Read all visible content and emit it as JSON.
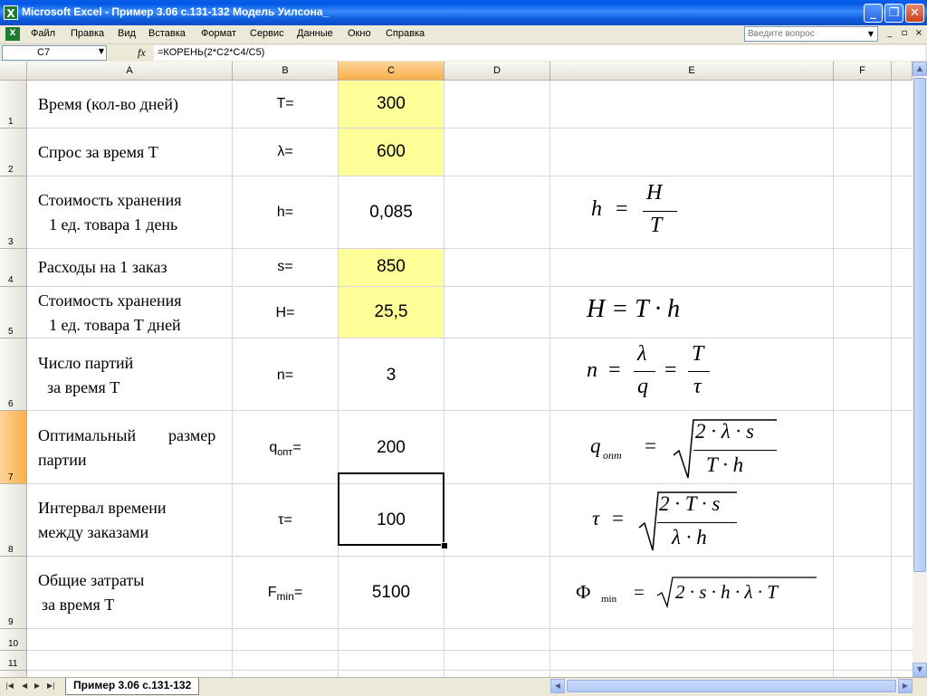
{
  "window": {
    "title": "Microsoft Excel - Пример 3.06 с.131-132 Модель Уилсона_",
    "icon": "excel-icon",
    "buttons": {
      "minimize": "_",
      "restore": "❐",
      "close": "✕"
    }
  },
  "menu": {
    "items": [
      "Файл",
      "Правка",
      "Вид",
      "Вставка",
      "Формат",
      "Сервис",
      "Данные",
      "Окно",
      "Справка"
    ],
    "help_placeholder": "Введите вопрос",
    "mdi": {
      "minimize": "_",
      "restore": "▫",
      "close": "×"
    }
  },
  "formula_bar": {
    "name_box": "C7",
    "fx_label": "fx",
    "formula": "=КОРЕНЬ(2*C2*C4/C5)"
  },
  "grid": {
    "columns": [
      "A",
      "B",
      "C",
      "D",
      "E",
      "F"
    ],
    "selected_column": "C",
    "rows": [
      "1",
      "2",
      "3",
      "4",
      "5",
      "6",
      "7",
      "8",
      "9",
      "10",
      "11",
      "12"
    ],
    "selected_row": "7",
    "cells": {
      "A1": "Время (кол-во дней)",
      "A2": "Спрос за время Т",
      "A3_line1": "Стоимость хранения",
      "A3_line2": "1 ед. товара 1 день",
      "A4": "Расходы на 1 заказ",
      "A5_line1": "Стоимость хранения",
      "A5_line2": "1 ед. товара Т дней",
      "A6_line1": "Число партий",
      "A6_line2": "за время Т",
      "A7_word1": "Оптимальный",
      "A7_word2": "размер",
      "A7_line2": "партии",
      "A8_line1": "Интервал времени",
      "A8_line2": "между заказами",
      "A9_line1": "Общие затраты",
      "A9_line2": "за время Т",
      "B1": "T=",
      "B2": "λ=",
      "B3": "h=",
      "B4": "s=",
      "B5": "H=",
      "B6": "n=",
      "B7_main": "q",
      "B7_sub": "опт",
      "B7_eq": "=",
      "B8": "τ=",
      "B9_main": "F",
      "B9_sub": "min",
      "B9_eq": "=",
      "C1": "300",
      "C2": "600",
      "C3": "0,085",
      "C4": "850",
      "C5": "25,5",
      "C6": "3",
      "C7": "200",
      "C8": "100",
      "C9": "5100"
    },
    "highlight_color": "#FFFF99",
    "formulas": {
      "f3": {
        "lhs": "h",
        "eq": "=",
        "num": "H",
        "den": "T"
      },
      "f5": {
        "text": "H = T · h"
      },
      "f6": {
        "lhs": "n",
        "eq1": "=",
        "num1": "λ",
        "den1": "q",
        "eq2": "=",
        "num2": "T",
        "den2": "τ"
      },
      "f7": {
        "lhs": "q",
        "sub": "опт",
        "eq": "=",
        "num": "2 · λ · s",
        "den": "T · h"
      },
      "f8": {
        "lhs": "τ",
        "eq": "=",
        "num": "2 · T · s",
        "den": "λ · h"
      },
      "f9": {
        "lhs": "Ф",
        "sub": "min",
        "eq": "=",
        "rad": "2 · s · h · λ · T"
      }
    }
  },
  "sheet_tabs": {
    "active": "Пример 3.06 с.131-132"
  }
}
